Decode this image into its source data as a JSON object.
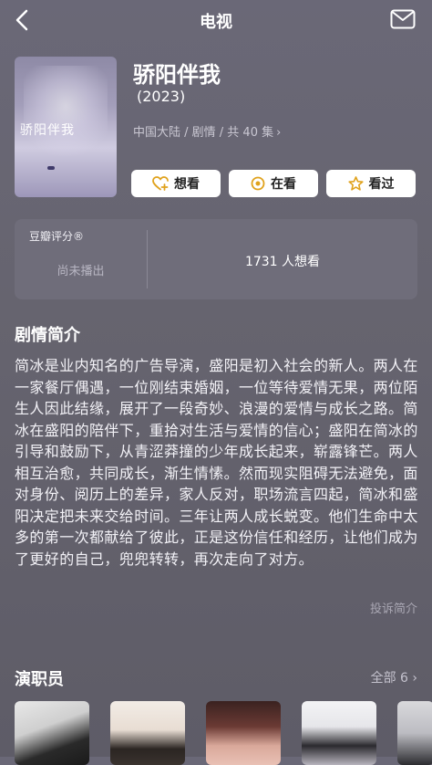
{
  "header": {
    "title": "电视"
  },
  "show": {
    "name": "骄阳伴我",
    "year": "(2023)",
    "meta": "中国大陆 / 剧情 / 共 40 集",
    "poster_title": "骄阳伴我"
  },
  "actions": {
    "want": "想看",
    "watching": "在看",
    "watched": "看过"
  },
  "rating": {
    "label": "豆瓣评分®",
    "status": "尚未播出",
    "want_count": "1731 人想看"
  },
  "synopsis": {
    "title": "剧情简介",
    "text": "简冰是业内知名的广告导演，盛阳是初入社会的新人。两人在一家餐厅偶遇，一位刚结束婚姻，一位等待爱情无果，两位陌生人因此结缘，展开了一段奇妙、浪漫的爱情与成长之路。简冰在盛阳的陪伴下，重拾对生活与爱情的信心；盛阳在简冰的引导和鼓励下，从青涩莽撞的少年成长起来，崭露锋芒。两人相互治愈，共同成长，渐生情愫。然而现实阻碍无法避免，面对身份、阅历上的差异，家人反对，职场流言四起，简冰和盛阳决定把未来交给时间。三年让两人成长蜕变。他们生命中太多的第一次都献给了彼此，正是这份信任和经历，让他们成为了更好的自己，兜兜转转，再次走向了对方。",
    "report": "投诉简介"
  },
  "cast": {
    "title": "演职员",
    "all_label": "全部 6"
  },
  "colors": {
    "background": "#66646f",
    "card": "#6f6d7a",
    "accent_gold": "#e0a21c"
  }
}
